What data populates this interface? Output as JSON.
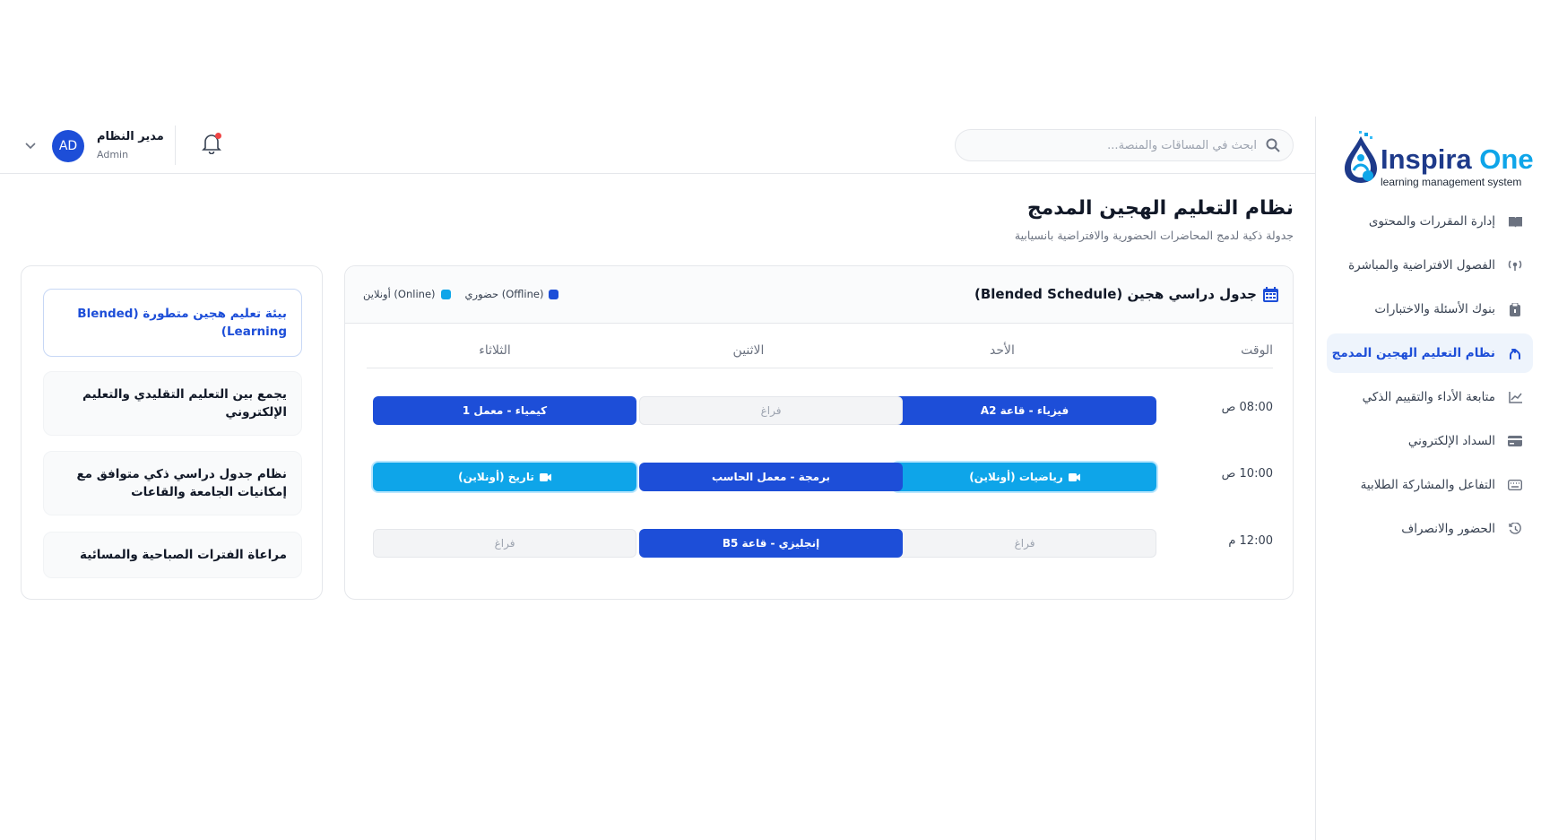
{
  "brand": {
    "name_main": "Inspira",
    "name_accent": "One",
    "tagline": "learning management system"
  },
  "sidebar": {
    "items": [
      {
        "label": "إدارة المقررات والمحتوى",
        "icon": "book-icon",
        "active": false
      },
      {
        "label": "الفصول الافتراضية والمباشرة",
        "icon": "broadcast-icon",
        "active": false
      },
      {
        "label": "بنوك الأسئلة والاختبارات",
        "icon": "clipboard-icon",
        "active": false
      },
      {
        "label": "نظام التعليم الهجين المدمج",
        "icon": "merge-icon",
        "active": true
      },
      {
        "label": "متابعة الأداء والتقييم الذكي",
        "icon": "chart-line-icon",
        "active": false
      },
      {
        "label": "السداد الإلكتروني",
        "icon": "card-icon",
        "active": false
      },
      {
        "label": "التفاعل والمشاركة الطلابية",
        "icon": "keyboard-icon",
        "active": false
      },
      {
        "label": "الحضور والانصراف",
        "icon": "history-icon",
        "active": false
      }
    ]
  },
  "header": {
    "search_placeholder": "ابحث في المساقات والمنصة...",
    "user_name": "مدير النظام",
    "user_role": "Admin",
    "avatar_initials": "AD"
  },
  "page": {
    "title": "نظام التعليم الهجين المدمج",
    "subtitle": "جدولة ذكية لدمج المحاضرات الحضورية والافتراضية بانسيابية"
  },
  "schedule": {
    "title": "جدول دراسي هجين (Blended Schedule)",
    "legend": {
      "offline": "حضوري (Offline)",
      "online": "أونلاين (Online)"
    },
    "columns": {
      "time": "الوقت",
      "sun": "الأحد",
      "mon": "الاثنين",
      "tue": "الثلاثاء"
    },
    "rows": [
      {
        "time": "08:00 ص",
        "sun": "فيزياء - قاعة A2",
        "mon": "فراغ",
        "tue": "كيمياء - معمل 1"
      },
      {
        "time": "10:00 ص",
        "sun": "رياضيات (أونلاين)",
        "mon": "برمجة - معمل الحاسب",
        "tue": "تاريخ (أونلاين)"
      },
      {
        "time": "12:00 م",
        "sun": "فراغ",
        "mon": "إنجليزي - قاعة B5",
        "tue": "فراغ"
      }
    ]
  },
  "features": [
    "بيئة تعليم هجين متطورة (Blended Learning)",
    "يجمع بين التعليم التقليدي والتعليم الإلكتروني",
    "نظام جدول دراسي ذكي متوافق مع إمكانيات الجامعة والقاعات",
    "مراعاة الفترات الصباحية والمسائية"
  ],
  "colors": {
    "primary": "#1d4ed8",
    "online": "#0ea5e9",
    "empty": "#f3f4f6",
    "active_nav_bg": "#eef4fc"
  }
}
